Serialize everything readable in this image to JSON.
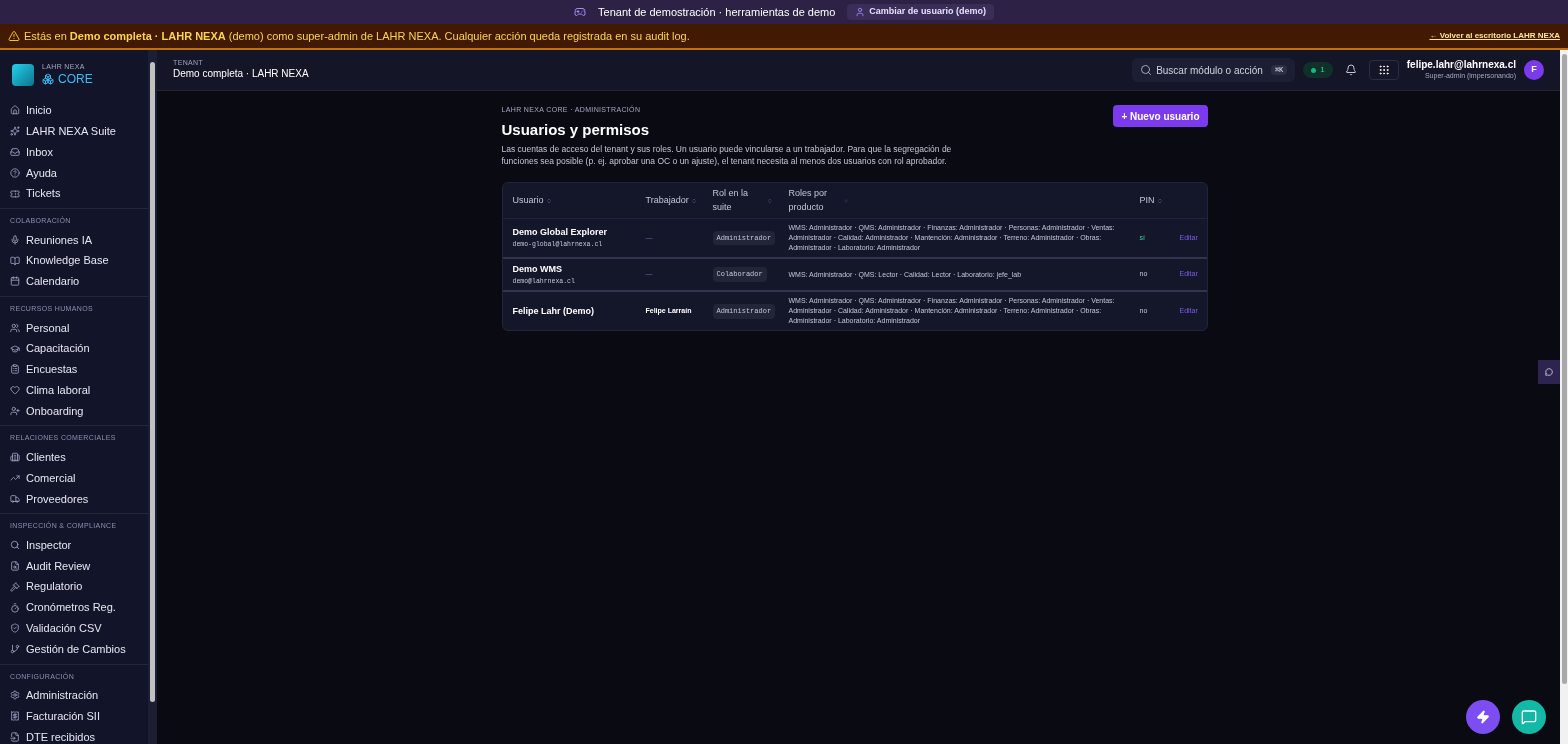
{
  "demo_bar": {
    "title": "Tenant de demostración · herramientas de demo",
    "switch_button": "Cambiar de usuario (demo)"
  },
  "warning": {
    "before": "Estás en **Demo completa · LAHR NEXA** (demo) como super-admin de LAHR NEXA. Cualquier acción queda registrada en su audit log.",
    "link": "← Volver al escritorio LAHR NEXA"
  },
  "brand": {
    "company": "LAHR NEXA",
    "product": "CORE"
  },
  "header": {
    "label": "TENANT",
    "tenant": "Demo completa · LAHR NEXA",
    "search_placeholder": "Buscar módulo o acción",
    "shortcut": "⌘K",
    "status_count": "1",
    "user_email": "felipe.lahr@lahrnexa.cl",
    "user_role": "Super-admin (impersonando)",
    "avatar": "F"
  },
  "sidebar": [
    {
      "items": [
        "Inicio",
        "LAHR NEXA Suite",
        "Inbox",
        "Ayuda",
        "Tickets"
      ]
    },
    {
      "title": "COLABORACIÓN",
      "items": [
        "Reuniones IA",
        "Knowledge Base",
        "Calendario"
      ]
    },
    {
      "title": "RECURSOS HUMANOS",
      "items": [
        "Personal",
        "Capacitación",
        "Encuestas",
        "Clima laboral",
        "Onboarding"
      ]
    },
    {
      "title": "RELACIONES COMERCIALES",
      "items": [
        "Clientes",
        "Comercial",
        "Proveedores"
      ]
    },
    {
      "title": "INSPECCIÓN & COMPLIANCE",
      "items": [
        "Inspector",
        "Audit Review",
        "Regulatorio",
        "Cronómetros Reg.",
        "Validación CSV",
        "Gestión de Cambios"
      ]
    },
    {
      "title": "CONFIGURACIÓN",
      "items": [
        "Administración",
        "Facturación SII",
        "DTE recibidos"
      ]
    }
  ],
  "page": {
    "breadcrumb": "LAHR NEXA CORE · ADMINISTRACIÓN",
    "title": "Usuarios y permisos",
    "description": "Las cuentas de acceso del tenant y sus roles. Un usuario puede vincularse a un trabajador. Para que la segregación de funciones sea posible (p. ej. aprobar una OC o un ajuste), el tenant necesita al menos dos usuarios con rol aprobador.",
    "new_button": "+ Nuevo usuario"
  },
  "table": {
    "columns": [
      {
        "label": "Usuario"
      },
      {
        "label": "Trabajador"
      },
      {
        "label": "Rol en la suite"
      },
      {
        "label": "Roles por producto"
      },
      {
        "label": "PIN"
      }
    ],
    "rows": [
      {
        "name": "Demo Global Explorer",
        "email": "demo-global@lahrnexa.cl",
        "worker": "—",
        "role": "Administrador",
        "products": "WMS: Administrador · QMS: Administrador · Finanzas: Administrador · Personas: Administrador · Ventas: Administrador · Calidad: Administrador · Mantención: Administrador · Terreno: Administrador · Obras: Administrador · Laboratorio: Administrador",
        "pin": "sí",
        "pin_set": true,
        "action": "Editar"
      },
      {
        "name": "Demo WMS",
        "email": "demo@lahrnexa.cl",
        "worker": "—",
        "role": "Colaborador",
        "products": "WMS: Administrador · QMS: Lector · Calidad: Lector · Laboratorio: jefe_lab",
        "pin": "no",
        "pin_set": false,
        "action": "Editar"
      },
      {
        "name": "Felipe Lahr (Demo)",
        "worker": "Felipe Larraín",
        "role": "Administrador",
        "products": "WMS: Administrador · QMS: Administrador · Finanzas: Administrador · Personas: Administrador · Ventas: Administrador · Calidad: Administrador · Mantención: Administrador · Terreno: Administrador · Obras: Administrador · Laboratorio: Administrador",
        "pin": "no",
        "pin_set": false,
        "action": "Editar"
      }
    ]
  }
}
